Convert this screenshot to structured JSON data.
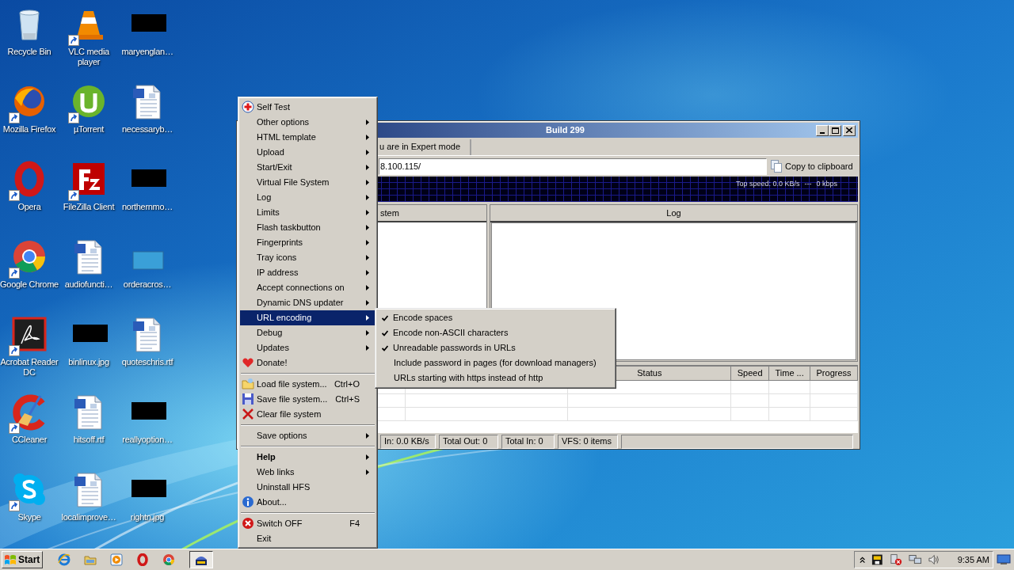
{
  "desktop_icons": [
    {
      "label": "Recycle Bin",
      "kind": "bin",
      "shortcut": false
    },
    {
      "label": "VLC media player",
      "kind": "cone",
      "shortcut": true
    },
    {
      "label": "maryenglan…",
      "shortcut": false
    },
    {
      "label": "Mozilla Firefox",
      "kind": "globe",
      "shortcut": true
    },
    {
      "label": "µTorrent",
      "kind": "circle-logo",
      "shortcut": true
    },
    {
      "label": "necessaryb…",
      "kind": "document",
      "shortcut": false
    },
    {
      "label": "Opera",
      "kind": "ring",
      "shortcut": true
    },
    {
      "label": "FileZilla Client",
      "kind": "square-logo",
      "shortcut": true
    },
    {
      "label": "northernmo…",
      "shortcut": false
    },
    {
      "label": "Google Chrome",
      "kind": "wheel",
      "shortcut": true
    },
    {
      "label": "audiofuncti…",
      "kind": "document",
      "shortcut": false
    },
    {
      "label": "orderacros…",
      "kind": "faint-image",
      "shortcut": false
    },
    {
      "label": "Acrobat Reader DC",
      "kind": "reader",
      "shortcut": true
    },
    {
      "label": "binlinux.jpg",
      "shortcut": false
    },
    {
      "label": "quoteschris.rtf",
      "kind": "document",
      "shortcut": false
    },
    {
      "label": "CCleaner",
      "kind": "brush",
      "shortcut": true
    },
    {
      "label": "hitsoff.rtf",
      "kind": "document",
      "shortcut": false
    },
    {
      "label": "reallyoption…",
      "shortcut": false
    },
    {
      "label": "Skype",
      "kind": "cloud",
      "shortcut": true
    },
    {
      "label": "localimprove…",
      "kind": "document",
      "shortcut": false
    },
    {
      "label": "rightn.jpg",
      "shortcut": false
    }
  ],
  "hfs_window": {
    "title": "Build 299",
    "mode_button": "u are in Expert mode",
    "url": "8.100.115/",
    "copy_button": "Copy to clipboard",
    "graph": {
      "top_speed": "Top speed: 0.0 KB/s",
      "separator": "---",
      "rate": "0 kbps"
    },
    "vfs_header": "stem",
    "log_header": "Log",
    "transfer_columns": [
      "Status",
      "Speed",
      "Time ...",
      "Progress"
    ],
    "status_bar": [
      "In: 0.0 KB/s",
      "Total Out: 0",
      "Total In: 0",
      "VFS: 0 items"
    ]
  },
  "context_menu": {
    "items": [
      {
        "kind": "item",
        "label": "Self Test",
        "submenu": false,
        "selected": false,
        "default": false
      },
      {
        "kind": "item",
        "label": "Other options",
        "submenu": true,
        "selected": false,
        "default": false
      },
      {
        "kind": "item",
        "label": "HTML template",
        "submenu": true,
        "selected": false,
        "default": false
      },
      {
        "kind": "item",
        "label": "Upload",
        "submenu": true,
        "selected": false,
        "default": false
      },
      {
        "kind": "item",
        "label": "Start/Exit",
        "submenu": true,
        "selected": false,
        "default": false
      },
      {
        "kind": "item",
        "label": "Virtual File System",
        "submenu": true,
        "selected": false,
        "default": false
      },
      {
        "kind": "item",
        "label": "Log",
        "submenu": true,
        "selected": false,
        "default": false
      },
      {
        "kind": "item",
        "label": "Limits",
        "submenu": true,
        "selected": false,
        "default": false
      },
      {
        "kind": "item",
        "label": "Flash taskbutton",
        "submenu": true,
        "selected": false,
        "default": false
      },
      {
        "kind": "item",
        "label": "Fingerprints",
        "submenu": true,
        "selected": false,
        "default": false
      },
      {
        "kind": "item",
        "label": "Tray icons",
        "submenu": true,
        "selected": false,
        "default": false
      },
      {
        "kind": "item",
        "label": "IP address",
        "submenu": true,
        "selected": false,
        "default": false
      },
      {
        "kind": "item",
        "label": "Accept connections on",
        "submenu": true,
        "selected": false,
        "default": false
      },
      {
        "kind": "item",
        "label": "Dynamic DNS updater",
        "submenu": true,
        "selected": false,
        "default": false
      },
      {
        "kind": "item",
        "label": "URL encoding",
        "submenu": true,
        "selected": true,
        "default": false
      },
      {
        "kind": "item",
        "label": "Debug",
        "submenu": true,
        "selected": false,
        "default": false
      },
      {
        "kind": "item",
        "label": "Updates",
        "submenu": true,
        "selected": false,
        "default": false
      },
      {
        "kind": "item",
        "label": "Donate!",
        "submenu": false,
        "selected": false,
        "default": false
      },
      {
        "kind": "separator"
      },
      {
        "kind": "item",
        "label": "Load file system...",
        "shortcut": "Ctrl+O",
        "submenu": false,
        "selected": false,
        "default": false
      },
      {
        "kind": "item",
        "label": "Save file system...",
        "shortcut": "Ctrl+S",
        "submenu": false,
        "selected": false,
        "default": false
      },
      {
        "kind": "item",
        "label": "Clear file system",
        "submenu": false,
        "selected": false,
        "default": false
      },
      {
        "kind": "separator"
      },
      {
        "kind": "item",
        "label": "Save options",
        "submenu": true,
        "selected": false,
        "default": false
      },
      {
        "kind": "separator"
      },
      {
        "kind": "item",
        "label": "Help",
        "submenu": true,
        "selected": false,
        "default": true
      },
      {
        "kind": "item",
        "label": "Web links",
        "submenu": true,
        "selected": false,
        "default": false
      },
      {
        "kind": "item",
        "label": "Uninstall HFS",
        "submenu": false,
        "selected": false,
        "default": false
      },
      {
        "kind": "item",
        "label": "About...",
        "submenu": false,
        "selected": false,
        "default": false
      },
      {
        "kind": "separator"
      },
      {
        "kind": "item",
        "label": "Switch OFF",
        "shortcut": "F4",
        "submenu": false,
        "selected": false,
        "default": false
      },
      {
        "kind": "item",
        "label": "Exit",
        "submenu": false,
        "selected": false,
        "default": false
      }
    ]
  },
  "submenu": {
    "items": [
      {
        "label": "Encode spaces",
        "checked": true
      },
      {
        "label": "Encode non-ASCII characters",
        "checked": true
      },
      {
        "label": "Unreadable passwords in URLs",
        "checked": true
      },
      {
        "label": "Include password in pages (for download managers)",
        "checked": false
      },
      {
        "label": "URLs starting with https instead of http",
        "checked": false
      }
    ]
  },
  "taskbar": {
    "start": "Start",
    "task_buttons": [
      {
        "selected": true
      }
    ],
    "clock": "9:35 AM"
  }
}
